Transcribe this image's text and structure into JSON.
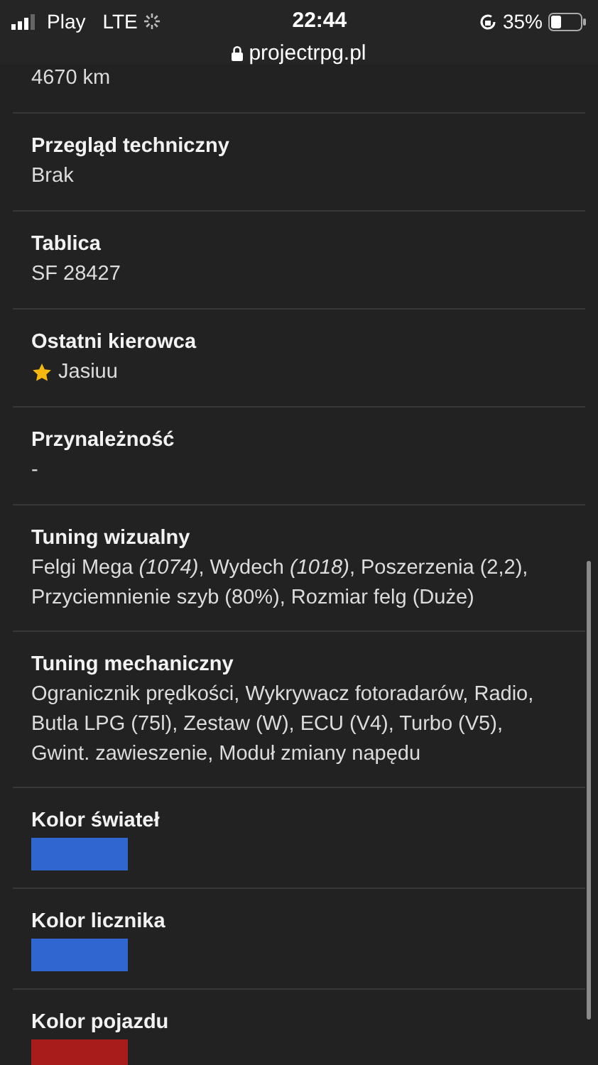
{
  "status_bar": {
    "carrier": "Play",
    "network": "LTE",
    "time": "22:44",
    "url": "projectrpg.pl",
    "battery": "35%"
  },
  "rows": [
    {
      "kind": "text",
      "value": "4670 km"
    },
    {
      "kind": "text",
      "title": "Przegląd techniczny",
      "value": "Brak"
    },
    {
      "kind": "text",
      "title": "Tablica",
      "value": "SF 28427"
    },
    {
      "kind": "driver",
      "title": "Ostatni kierowca",
      "value": "Jasiuu"
    },
    {
      "kind": "text",
      "title": "Przynależność",
      "value": "-"
    },
    {
      "kind": "text",
      "title": "Tuning wizualny",
      "value": "Felgi Mega *(1074)*, Wydech *(1018)*, Poszerzenia (2,2), Przyciemnienie szyb (80%), Rozmiar felg (Duże)"
    },
    {
      "kind": "text",
      "title": "Tuning mechaniczny",
      "value": "Ogranicznik prędkości, Wykrywacz fotoradarów, Radio, Butla LPG (75l), Zestaw (W), ECU (V4), Turbo (V5), Gwint. zawieszenie, Moduł zmiany napędu"
    },
    {
      "kind": "color",
      "title": "Kolor świateł",
      "color": "#3066d0"
    },
    {
      "kind": "color",
      "title": "Kolor licznika",
      "color": "#3066d0"
    },
    {
      "kind": "color",
      "title": "Kolor pojazdu",
      "color": "#a81c1c"
    }
  ]
}
